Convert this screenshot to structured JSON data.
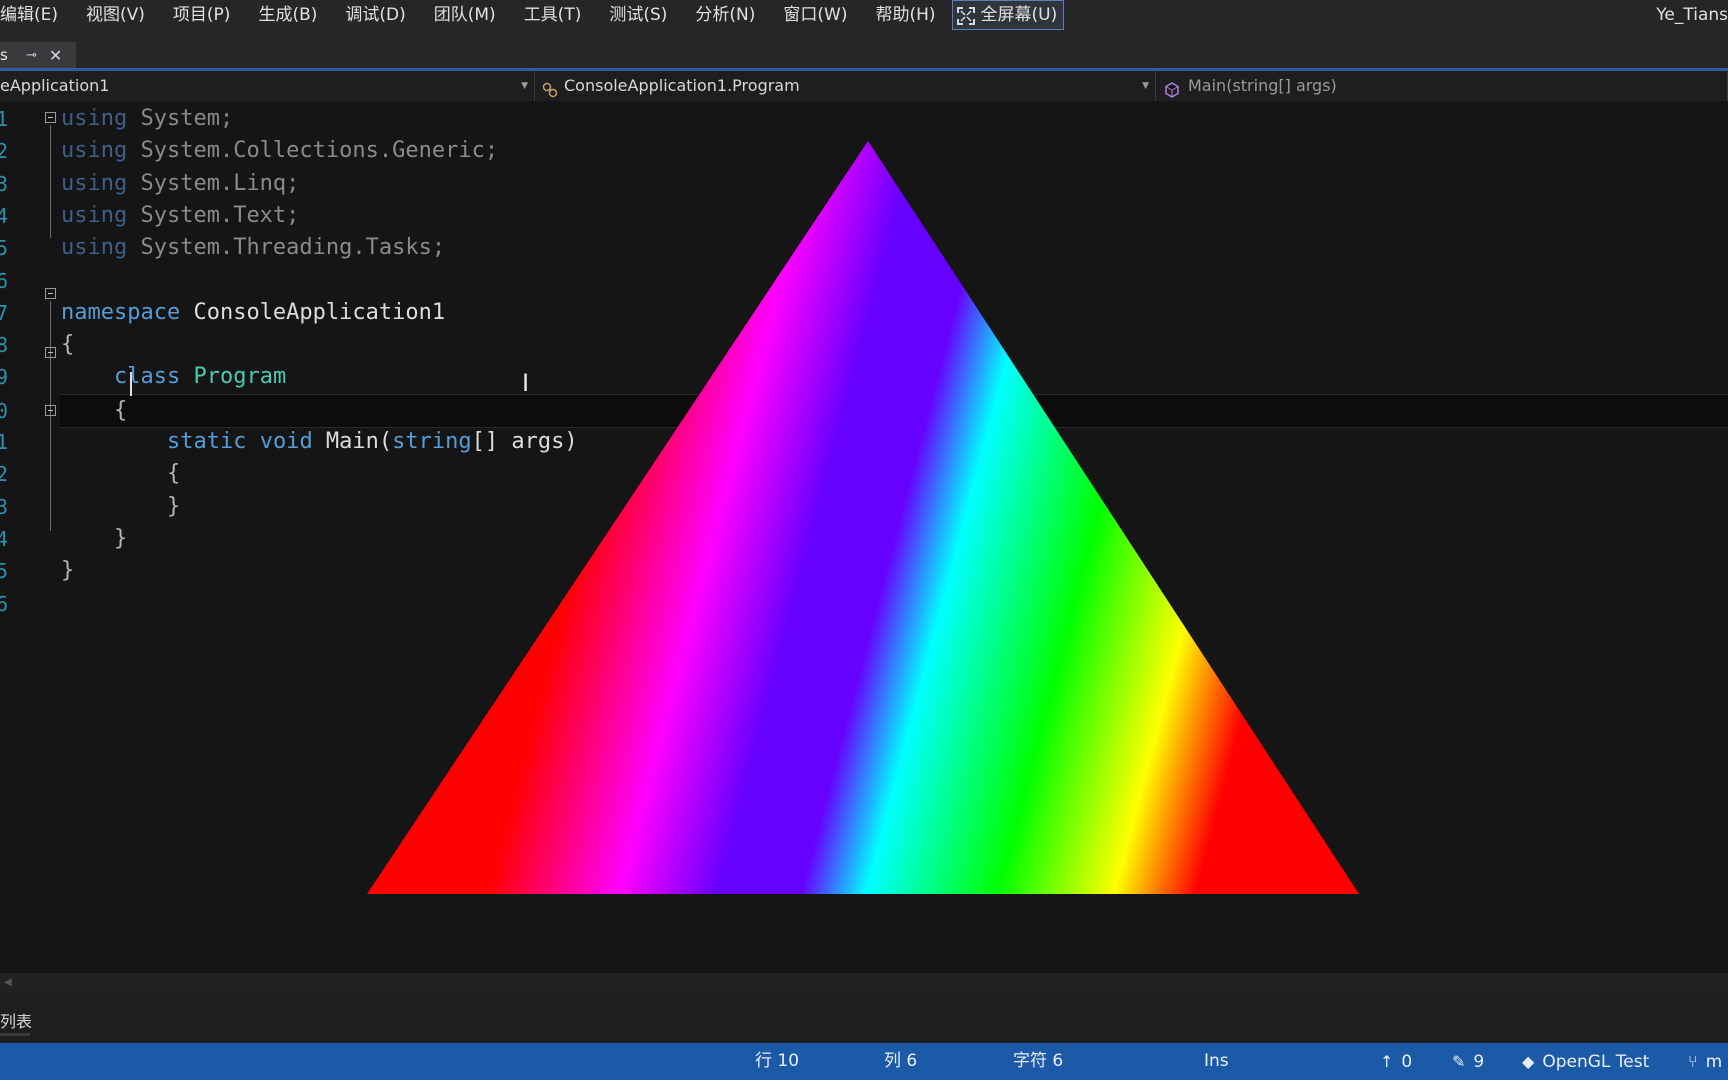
{
  "menu": {
    "items": [
      "编辑(E)",
      "视图(V)",
      "项目(P)",
      "生成(B)",
      "调试(D)",
      "团队(M)",
      "工具(T)",
      "测试(S)",
      "分析(N)",
      "窗口(W)",
      "帮助(H)"
    ],
    "fullscreen_label": "全屏幕(U)",
    "user": "Ye_Tians"
  },
  "tab": {
    "name": "s",
    "pin_icon": "pin-icon",
    "close_icon": "close-icon"
  },
  "navbar": {
    "project": "eApplication1",
    "class": "ConsoleApplication1.Program",
    "member": "Main(string[] args)"
  },
  "editor": {
    "lines": [
      {
        "no": "1",
        "tokens": [
          [
            "kw-dim",
            "using"
          ],
          [
            "ns-dim",
            " System;"
          ]
        ]
      },
      {
        "no": "2",
        "tokens": [
          [
            "kw-dim",
            "using"
          ],
          [
            "ns-dim",
            " System.Collections.Generic;"
          ]
        ]
      },
      {
        "no": "3",
        "tokens": [
          [
            "kw-dim",
            "using"
          ],
          [
            "ns-dim",
            " System.Linq;"
          ]
        ]
      },
      {
        "no": "4",
        "tokens": [
          [
            "kw-dim",
            "using"
          ],
          [
            "ns-dim",
            " System.Text;"
          ]
        ]
      },
      {
        "no": "5",
        "tokens": [
          [
            "kw-dim",
            "using"
          ],
          [
            "ns-dim",
            " System.Threading.Tasks;"
          ]
        ]
      },
      {
        "no": "6",
        "tokens": []
      },
      {
        "no": "7",
        "tokens": [
          [
            "kw",
            "namespace"
          ],
          [
            "plain",
            " ConsoleApplication1"
          ]
        ]
      },
      {
        "no": "8",
        "tokens": [
          [
            "punct",
            "{"
          ]
        ]
      },
      {
        "no": "9",
        "tokens": [
          [
            "plain",
            "    "
          ],
          [
            "kw",
            "class"
          ],
          [
            "plain",
            " "
          ],
          [
            "ty",
            "Program"
          ]
        ]
      },
      {
        "no": "0",
        "tokens": [
          [
            "punct",
            "    {"
          ]
        ]
      },
      {
        "no": "1",
        "tokens": [
          [
            "plain",
            "        "
          ],
          [
            "kw",
            "static"
          ],
          [
            "plain",
            " "
          ],
          [
            "kw",
            "void"
          ],
          [
            "plain",
            " Main("
          ],
          [
            "kw",
            "string"
          ],
          [
            "plain",
            "[] args)"
          ]
        ]
      },
      {
        "no": "2",
        "tokens": [
          [
            "punct",
            "        {"
          ]
        ]
      },
      {
        "no": "3",
        "tokens": [
          [
            "punct",
            "        }"
          ]
        ]
      },
      {
        "no": "4",
        "tokens": [
          [
            "punct",
            "    }"
          ]
        ]
      },
      {
        "no": "5",
        "tokens": [
          [
            "punct",
            "}"
          ]
        ]
      },
      {
        "no": "6",
        "tokens": []
      }
    ],
    "current_line_index": 9
  },
  "bottom_panel": {
    "tab_label": "列表"
  },
  "status": {
    "line": "行 10",
    "col": "列 6",
    "char": "字符 6",
    "mode": "Ins",
    "up_count": "0",
    "edit_count": "9",
    "repo": "OpenGL Test",
    "branch": "m"
  },
  "triangle": {
    "colors": [
      "#ff0000",
      "#ff00ff",
      "#6600ff",
      "#00ffff",
      "#00ff00",
      "#ffff00",
      "#ff0000"
    ]
  }
}
